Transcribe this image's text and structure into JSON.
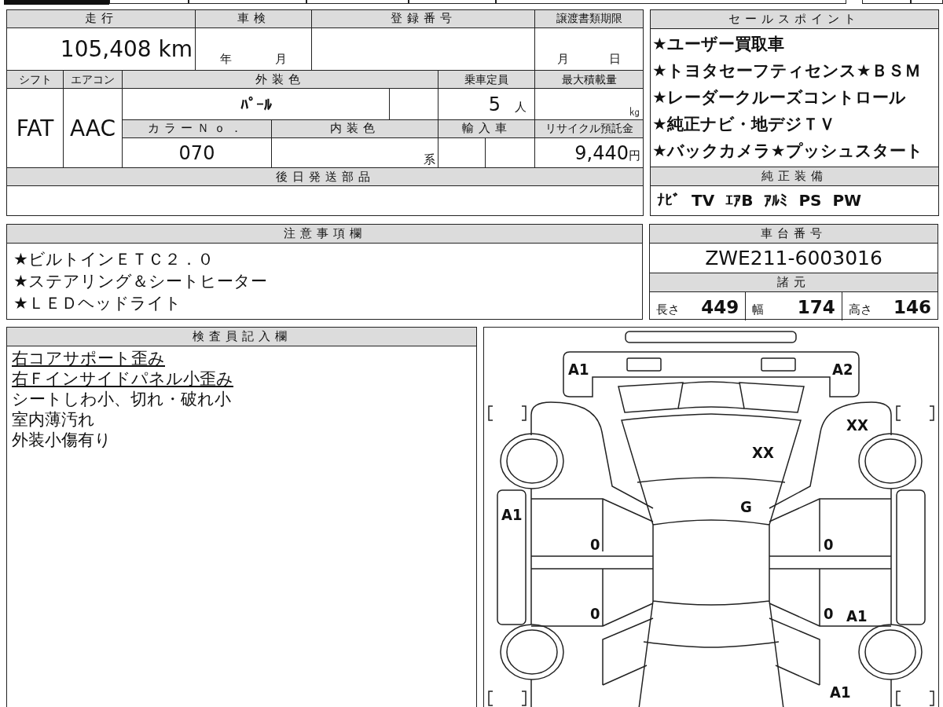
{
  "vehicle_table": {
    "mileage": {
      "label": "走行",
      "value": "105,408 km"
    },
    "inspection": {
      "label": "車検",
      "year_unit": "年",
      "month_unit": "月"
    },
    "registration_number": {
      "label": "登録番号"
    },
    "transfer_docs_deadline": {
      "label": "譲渡書類期限",
      "month_unit": "月",
      "day_unit": "日"
    },
    "shift": {
      "label": "シフト",
      "value": "FAT"
    },
    "aircon": {
      "label": "エアコン",
      "value": "AAC"
    },
    "exterior_color": {
      "label": "外装色",
      "value": "ﾊﾟｰﾙ"
    },
    "capacity": {
      "label": "乗車定員",
      "value": "5",
      "unit": "人"
    },
    "max_load": {
      "label": "最大積載量",
      "unit": "㎏"
    },
    "color_no": {
      "label": "カラーＮｏ．",
      "value": "070"
    },
    "interior_color": {
      "label": "内装色",
      "unit": "系"
    },
    "import": {
      "label": "輸入車"
    },
    "recycle_deposit": {
      "label": "リサイクル預託金",
      "value": "9,440",
      "unit": "円"
    },
    "later_parts": {
      "label": "後日発送部品"
    }
  },
  "sales_points": {
    "label": "セールスポイント",
    "items": [
      "★ユーザー買取車",
      "★トヨタセーフティセンス★ＢＳＭ",
      "★レーダークルーズコントロール",
      "★純正ナビ・地デジＴＶ",
      "★バックカメラ★プッシュスタート"
    ]
  },
  "equipment": {
    "label": "純正装備",
    "items": [
      "ﾅﾋﾞ",
      "TV",
      "ｴｱB",
      "ｱﾙﾐ",
      "PS",
      "PW"
    ]
  },
  "notes": {
    "label": "注意事項欄",
    "items": [
      "★ビルトインＥＴＣ２．０",
      "★ステアリング＆シートヒーター",
      "★ＬＥＤヘッドライト"
    ]
  },
  "chassis": {
    "label": "車台番号",
    "value": "ZWE211-6003016"
  },
  "specs": {
    "label": "諸元",
    "items": [
      {
        "label": "長さ",
        "value": "449"
      },
      {
        "label": "幅",
        "value": "174"
      },
      {
        "label": "高さ",
        "value": "146"
      }
    ]
  },
  "inspector": {
    "label": "検査員記入欄",
    "lines": [
      {
        "text": "右コアサポート歪み",
        "underlined": true
      },
      {
        "text": "右Ｆインサイドパネル小歪み",
        "underlined": true
      },
      {
        "text": "シートしわ小、切れ・破れ小",
        "underlined": false
      },
      {
        "text": "室内薄汚れ",
        "underlined": false
      },
      {
        "text": "外装小傷有り",
        "underlined": false
      }
    ]
  },
  "diagram": {
    "marks": [
      {
        "code": "A1"
      },
      {
        "code": "A2"
      },
      {
        "code": "XX"
      },
      {
        "code": "XX"
      },
      {
        "code": "G"
      },
      {
        "code": "A1"
      },
      {
        "code": "0"
      },
      {
        "code": "0"
      },
      {
        "code": "0"
      },
      {
        "code": "0"
      },
      {
        "code": "A1"
      },
      {
        "code": "A1"
      }
    ]
  }
}
